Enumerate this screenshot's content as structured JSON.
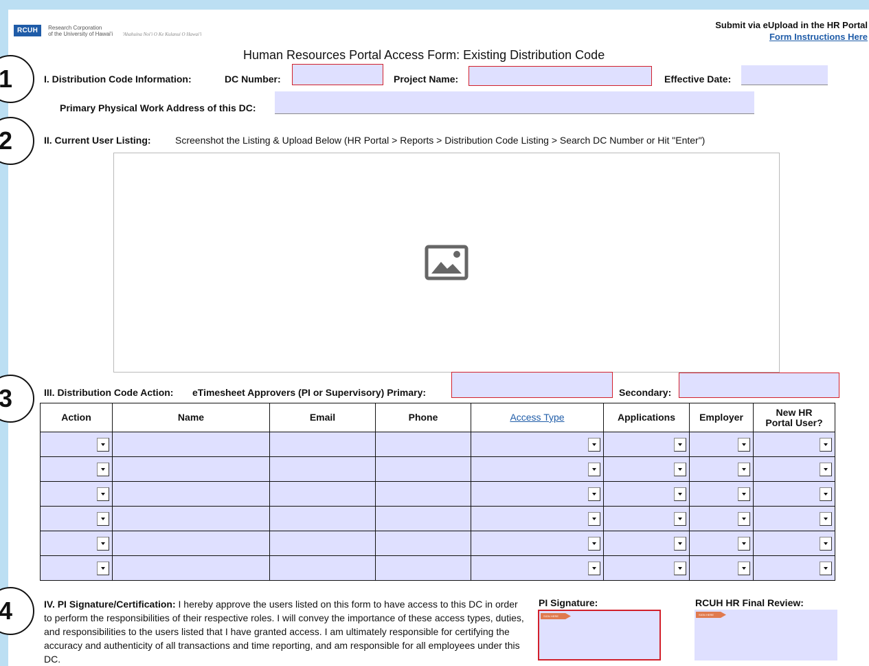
{
  "header": {
    "logo_mark": "RCUH",
    "logo_line1": "Research Corporation",
    "logo_line2": "of the University of Hawai'i",
    "logo_tagline": "'Ahahuina Noi'i O Ke Kulanui O Hawai'i",
    "submit_text": "Submit via eUpload in the HR Portal",
    "instructions_link": "Form Instructions Here",
    "title": "Human Resources Portal Access Form: Existing Distribution Code"
  },
  "steps": [
    "1",
    "2",
    "3",
    "4"
  ],
  "section1": {
    "heading": "I.   Distribution Code Information:",
    "dc_number_label": "DC Number:",
    "dc_number_value": "",
    "project_name_label": "Project Name:",
    "project_name_value": "",
    "effective_date_label": "Effective Date:",
    "effective_date_value": "",
    "address_label": "Primary Physical Work Address of this DC:",
    "address_value": ""
  },
  "section2": {
    "heading": "II.   Current User Listing:",
    "instructions": "Screenshot the Listing & Upload Below (HR Portal > Reports > Distribution Code Listing > Search DC Number or Hit \"Enter\")"
  },
  "section3": {
    "heading": "III. Distribution Code Action:",
    "approvers_label": "eTimesheet Approvers (PI or Supervisory) Primary:",
    "primary_value": "",
    "secondary_label": "Secondary:",
    "secondary_value": ""
  },
  "table": {
    "headers": {
      "action": "Action",
      "name": "Name",
      "email": "Email",
      "phone": "Phone",
      "access_type": "Access Type",
      "applications": "Applications",
      "employer": "Employer",
      "new_user_line1": "New HR",
      "new_user_line2": "Portal User?"
    },
    "rows": [
      {
        "action": "",
        "name": "",
        "email": "",
        "phone": "",
        "access_type": "",
        "applications": "",
        "employer": "",
        "new_user": ""
      },
      {
        "action": "",
        "name": "",
        "email": "",
        "phone": "",
        "access_type": "",
        "applications": "",
        "employer": "",
        "new_user": ""
      },
      {
        "action": "",
        "name": "",
        "email": "",
        "phone": "",
        "access_type": "",
        "applications": "",
        "employer": "",
        "new_user": ""
      },
      {
        "action": "",
        "name": "",
        "email": "",
        "phone": "",
        "access_type": "",
        "applications": "",
        "employer": "",
        "new_user": ""
      },
      {
        "action": "",
        "name": "",
        "email": "",
        "phone": "",
        "access_type": "",
        "applications": "",
        "employer": "",
        "new_user": ""
      },
      {
        "action": "",
        "name": "",
        "email": "",
        "phone": "",
        "access_type": "",
        "applications": "",
        "employer": "",
        "new_user": ""
      }
    ]
  },
  "section4": {
    "heading": "IV. PI Signature/Certification:",
    "certification_text": "I hereby approve the users listed on this form to have access to this DC in order to perform the responsibilities of their respective roles. I will convey the importance of these access types, duties, and responsibilities to the users listed that I have granted access. I am ultimately responsible for certifying the accuracy and authenticity of all transactions and time reporting, and am responsible for all employees under this DC.",
    "pi_signature_label": "PI Signature:",
    "final_review_label": "RCUH HR Final Review:",
    "sign_flag_text": "SIGN HERE"
  },
  "colors": {
    "field_fill": "#dfe0ff",
    "required_border": "#d21f2a",
    "link": "#1f5ca8",
    "page_bg": "#bcdff3"
  }
}
